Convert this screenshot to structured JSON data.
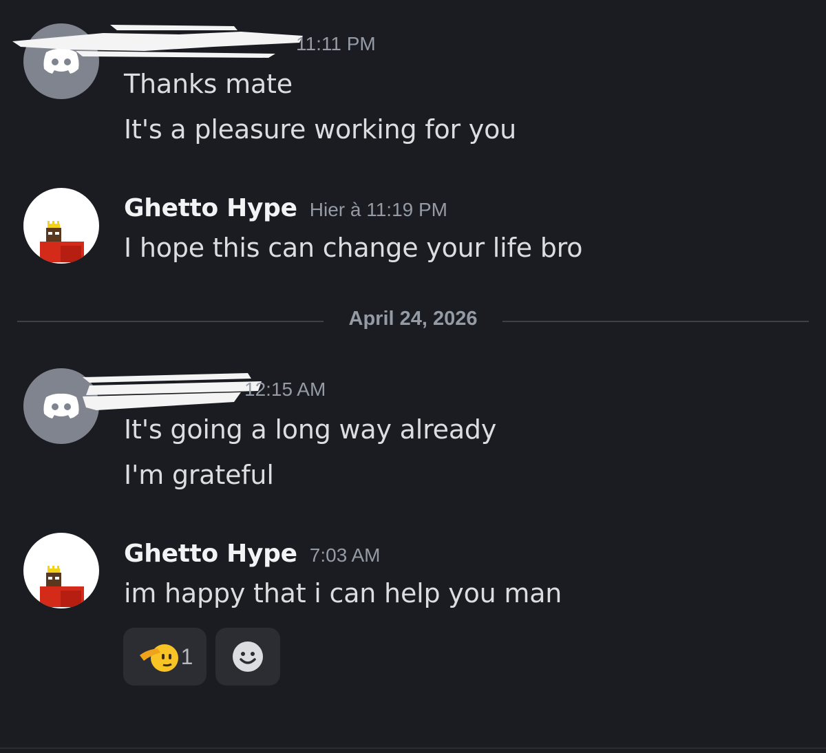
{
  "messages": [
    {
      "author": "",
      "avatar": "discord-default-avatar",
      "timestamp": "11:11 PM",
      "lines": [
        "Thanks mate",
        "It's a pleasure working for you"
      ]
    },
    {
      "author": "Ghetto Hype",
      "avatar": "pixel-king-avatar",
      "timestamp": "Hier à 11:19 PM",
      "lines": [
        "I hope this can change your life bro"
      ]
    },
    {
      "author": "",
      "avatar": "discord-default-avatar",
      "timestamp": "12:15 AM",
      "lines": [
        "It's going a long way already",
        "I'm grateful"
      ]
    },
    {
      "author": "Ghetto Hype",
      "avatar": "pixel-king-avatar",
      "timestamp": "7:03 AM",
      "lines": [
        "im happy that i can help you man"
      ],
      "reactions": [
        {
          "emoji": "saluting-face",
          "count": "1"
        }
      ]
    }
  ],
  "date_divider": "April 24, 2026",
  "add_reaction_icon": "smiley-face-icon",
  "colors": {
    "background": "#1b1c21",
    "text": "#dbdee1",
    "muted": "#949ba4",
    "username": "#f2f3f5",
    "reaction_bg": "#2b2d33"
  }
}
